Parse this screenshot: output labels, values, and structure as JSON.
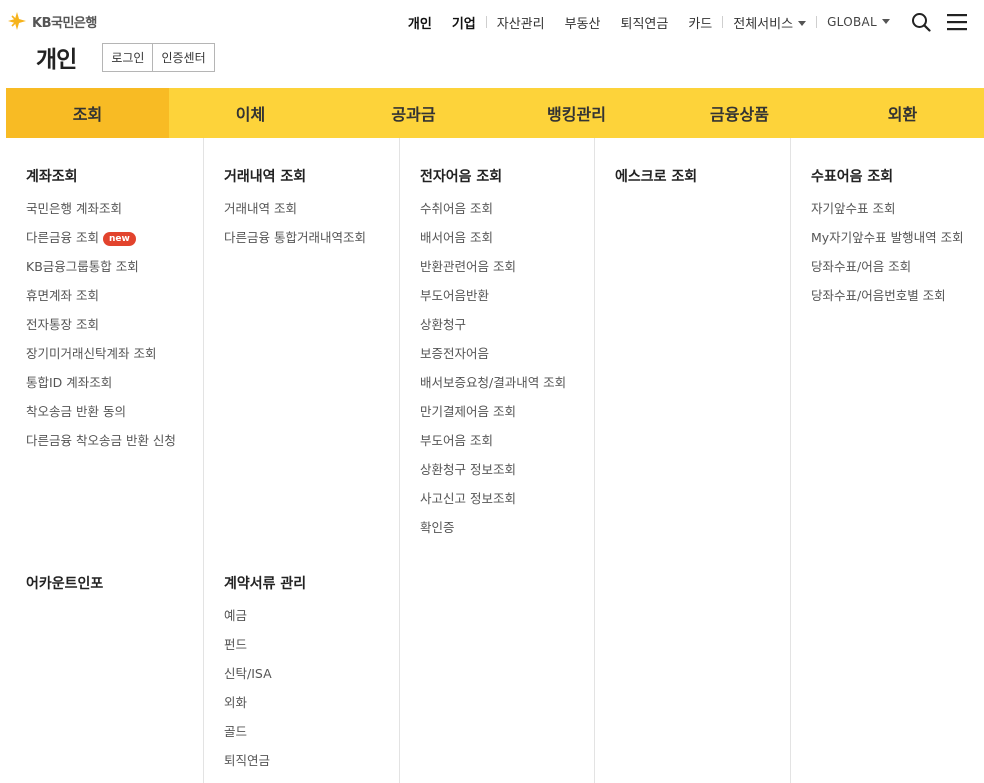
{
  "brand": {
    "name": "KB국민은행",
    "accent": "#f6b31b"
  },
  "topnav": {
    "items": [
      {
        "label": "개인",
        "bold": true
      },
      {
        "label": "기업",
        "bold": true
      },
      {
        "label": "자산관리"
      },
      {
        "label": "부동산"
      },
      {
        "label": "퇴직연금"
      },
      {
        "label": "카드"
      },
      {
        "label": "전체서비스"
      },
      {
        "label": "GLOBAL"
      }
    ],
    "search_icon": "search-icon",
    "menu_icon": "hamburger-menu-icon"
  },
  "page": {
    "title": "개인",
    "login_label": "로그인",
    "cert_label": "인증센터"
  },
  "menubar": {
    "colors": {
      "bar": "#fdd33a",
      "active": "#f8bb24"
    },
    "items": [
      "조회",
      "이체",
      "공과금",
      "뱅킹관리",
      "금융상품",
      "외환"
    ],
    "active_index": 0
  },
  "columns": [
    {
      "groups": [
        {
          "title": "계좌조회",
          "links": [
            "국민은행 계좌조회",
            "다른금융 조회",
            "KB금융그룹통합 조회",
            "휴면계좌 조회",
            "전자통장 조회",
            "장기미거래신탁계좌 조회",
            "통합ID 계좌조회",
            "착오송금 반환 동의",
            "다른금융 착오송금 반환 신청"
          ],
          "badge_on": 1,
          "badge_label": "new"
        },
        {
          "title": "어카운트인포",
          "links": []
        }
      ]
    },
    {
      "groups": [
        {
          "title": "거래내역 조회",
          "links": [
            "거래내역 조회",
            "다른금융 통합거래내역조회"
          ]
        },
        {
          "title": "계약서류 관리",
          "links": [
            "예금",
            "펀드",
            "신탁/ISA",
            "외화",
            "골드",
            "퇴직연금"
          ]
        }
      ]
    },
    {
      "groups": [
        {
          "title": "전자어음 조회",
          "links": [
            "수취어음 조회",
            "배서어음 조회",
            "반환관련어음 조회",
            "부도어음반환",
            "상환청구",
            "보증전자어음",
            "배서보증요청/결과내역 조회",
            "만기결제어음 조회",
            "부도어음 조회",
            "상환청구 정보조회",
            "사고신고 정보조회",
            "확인증"
          ]
        }
      ]
    },
    {
      "groups": [
        {
          "title": "에스크로 조회",
          "links": []
        }
      ]
    },
    {
      "groups": [
        {
          "title": "수표어음 조회",
          "links": [
            "자기앞수표 조회",
            "My자기앞수표 발행내역 조회",
            "당좌수표/어음 조회",
            "당좌수표/어음번호별 조회"
          ]
        }
      ]
    }
  ]
}
